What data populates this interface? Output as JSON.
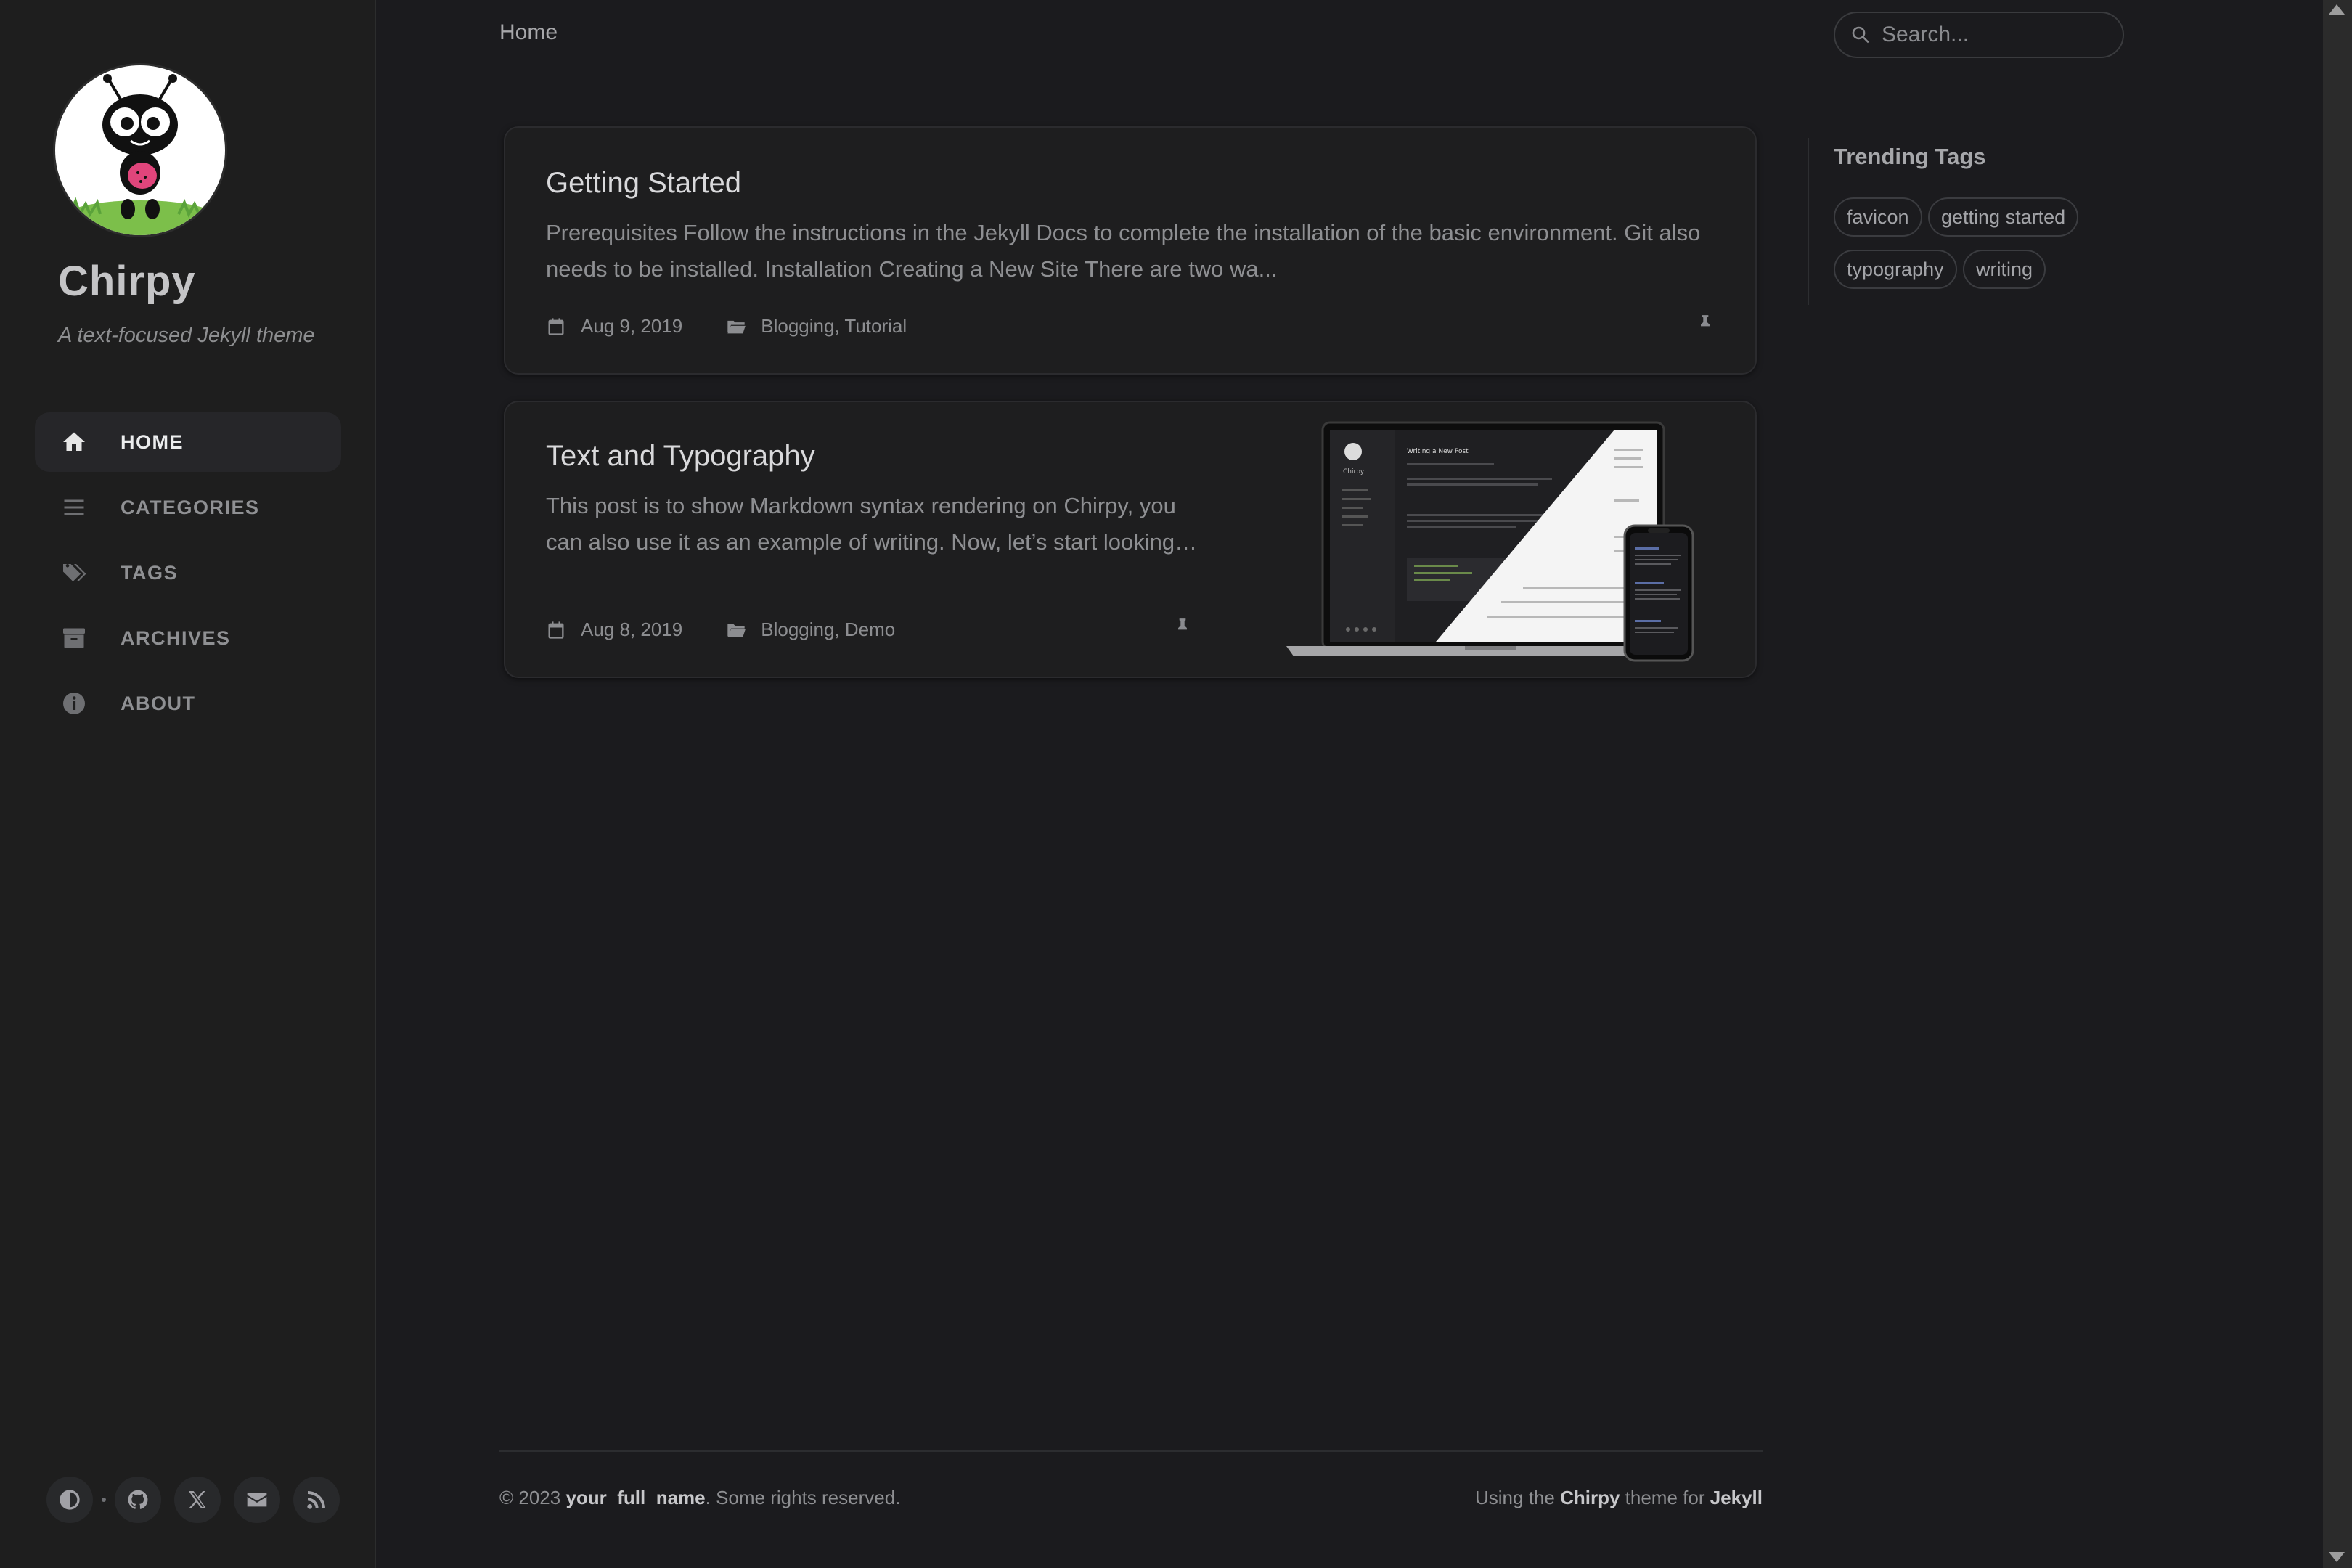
{
  "sidebar": {
    "site_title": "Chirpy",
    "site_subtitle": "A text-focused Jekyll theme",
    "nav": [
      {
        "label": "HOME",
        "icon": "home-icon",
        "active": true
      },
      {
        "label": "CATEGORIES",
        "icon": "list-icon",
        "active": false
      },
      {
        "label": "TAGS",
        "icon": "tags-icon",
        "active": false
      },
      {
        "label": "ARCHIVES",
        "icon": "archive-icon",
        "active": false
      },
      {
        "label": "ABOUT",
        "icon": "info-icon",
        "active": false
      }
    ],
    "bottom_icons": [
      "theme-toggle-icon",
      "github-icon",
      "x-twitter-icon",
      "email-icon",
      "rss-icon"
    ]
  },
  "topbar": {
    "breadcrumb": "Home",
    "search_placeholder": "Search..."
  },
  "posts": [
    {
      "title": "Getting Started",
      "excerpt_line1": "Prerequisites Follow the instructions in the Jekyll Docs to complete the installation of the basic environment. Git also",
      "excerpt_line2": "needs to be installed. Installation Creating a New Site There are two wa...",
      "date": "Aug 9, 2019",
      "categories": "Blogging, Tutorial",
      "pinned": true
    },
    {
      "title": "Text and Typography",
      "excerpt_line1": "This post is to show Markdown syntax rendering on Chirpy, you",
      "excerpt_line2": "can also use it as an example of writing. Now, let’s start looking…",
      "date": "Aug 8, 2019",
      "categories": "Blogging, Demo",
      "pinned": true,
      "preview_image": "laptop-and-phone-devices-mockup",
      "mockup": {
        "site_title": "Chirpy",
        "post_title": "Writing a New Post"
      }
    }
  ],
  "trending": {
    "title": "Trending Tags",
    "tags": [
      "favicon",
      "getting started",
      "typography",
      "writing"
    ]
  },
  "footer": {
    "copyright_prefix": "© 2023 ",
    "author": "your_full_name",
    "rights": ". Some rights reserved.",
    "using": "Using the ",
    "theme": "Chirpy",
    "theme_for": " theme for ",
    "engine": "Jekyll"
  },
  "colors": {
    "background": "#1b1b1e",
    "sidebar": "#1e1e1e",
    "card": "#1e1e1f",
    "active_nav": "#262629"
  }
}
